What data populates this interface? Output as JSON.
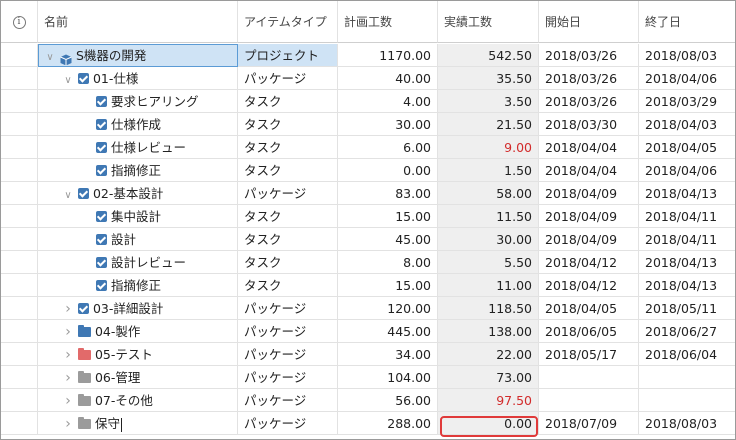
{
  "columns": {
    "info": "i",
    "name": "名前",
    "item_type": "アイテムタイプ",
    "planned": "計画工数",
    "actual": "実績工数",
    "start": "開始日",
    "end": "終了日"
  },
  "colors": {
    "selected_bg": "#cfe3f5",
    "actual_col_bg": "#efefef",
    "over_budget": "#d22b2b",
    "task_check": "#3f78b4",
    "highlight_border": "#e03a3a"
  },
  "rows": [
    {
      "name": "S機器の開発",
      "type": "プロジェクト",
      "planned": "1170.00",
      "actual": "542.50",
      "start": "2018/03/26",
      "end": "2018/08/03",
      "level": 0,
      "icon": "project-box-icon",
      "expand": "expanded"
    },
    {
      "name": "01-仕様",
      "type": "パッケージ",
      "planned": "40.00",
      "actual": "35.50",
      "start": "2018/03/26",
      "end": "2018/04/06",
      "level": 1,
      "icon": "check-icon",
      "expand": "expanded"
    },
    {
      "name": "要求ヒアリング",
      "type": "タスク",
      "planned": "4.00",
      "actual": "3.50",
      "start": "2018/03/26",
      "end": "2018/03/29",
      "level": 2,
      "icon": "check-icon",
      "expand": "none"
    },
    {
      "name": "仕様作成",
      "type": "タスク",
      "planned": "30.00",
      "actual": "21.50",
      "start": "2018/03/30",
      "end": "2018/04/03",
      "level": 2,
      "icon": "check-icon",
      "expand": "none"
    },
    {
      "name": "仕様レビュー",
      "type": "タスク",
      "planned": "6.00",
      "actual": "9.00",
      "start": "2018/04/04",
      "end": "2018/04/05",
      "level": 2,
      "icon": "check-icon",
      "expand": "none",
      "over": true
    },
    {
      "name": "指摘修正",
      "type": "タスク",
      "planned": "0.00",
      "actual": "1.50",
      "start": "2018/04/04",
      "end": "2018/04/06",
      "level": 2,
      "icon": "check-icon",
      "expand": "none"
    },
    {
      "name": "02-基本設計",
      "type": "パッケージ",
      "planned": "83.00",
      "actual": "58.00",
      "start": "2018/04/09",
      "end": "2018/04/13",
      "level": 1,
      "icon": "check-icon",
      "expand": "expanded"
    },
    {
      "name": "集中設計",
      "type": "タスク",
      "planned": "15.00",
      "actual": "11.50",
      "start": "2018/04/09",
      "end": "2018/04/11",
      "level": 2,
      "icon": "check-icon",
      "expand": "none"
    },
    {
      "name": "設計",
      "type": "タスク",
      "planned": "45.00",
      "actual": "30.00",
      "start": "2018/04/09",
      "end": "2018/04/11",
      "level": 2,
      "icon": "check-icon",
      "expand": "none"
    },
    {
      "name": "設計レビュー",
      "type": "タスク",
      "planned": "8.00",
      "actual": "5.50",
      "start": "2018/04/12",
      "end": "2018/04/13",
      "level": 2,
      "icon": "check-icon",
      "expand": "none"
    },
    {
      "name": "指摘修正",
      "type": "タスク",
      "planned": "15.00",
      "actual": "11.00",
      "start": "2018/04/12",
      "end": "2018/04/13",
      "level": 2,
      "icon": "check-icon",
      "expand": "none"
    },
    {
      "name": "03-詳細設計",
      "type": "パッケージ",
      "planned": "120.00",
      "actual": "118.50",
      "start": "2018/04/05",
      "end": "2018/05/11",
      "level": 1,
      "icon": "check-icon",
      "expand": "collapsed"
    },
    {
      "name": "04-製作",
      "type": "パッケージ",
      "planned": "445.00",
      "actual": "138.00",
      "start": "2018/06/05",
      "end": "2018/06/27",
      "level": 1,
      "icon": "folder-blue-icon",
      "expand": "collapsed"
    },
    {
      "name": "05-テスト",
      "type": "パッケージ",
      "planned": "34.00",
      "actual": "22.00",
      "start": "2018/05/17",
      "end": "2018/06/04",
      "level": 1,
      "icon": "folder-red-icon",
      "expand": "collapsed"
    },
    {
      "name": "06-管理",
      "type": "パッケージ",
      "planned": "104.00",
      "actual": "73.00",
      "start": "",
      "end": "",
      "level": 1,
      "icon": "folder-gray-icon",
      "expand": "collapsed"
    },
    {
      "name": "07-その他",
      "type": "パッケージ",
      "planned": "56.00",
      "actual": "97.50",
      "start": "",
      "end": "",
      "level": 1,
      "icon": "folder-gray-icon",
      "expand": "collapsed",
      "over": true
    },
    {
      "name": "保守",
      "type": "パッケージ",
      "planned": "288.00",
      "actual": "0.00",
      "start": "2018/07/09",
      "end": "2018/08/03",
      "level": 1,
      "icon": "folder-gray-icon",
      "expand": "collapsed",
      "editing": true
    }
  ]
}
